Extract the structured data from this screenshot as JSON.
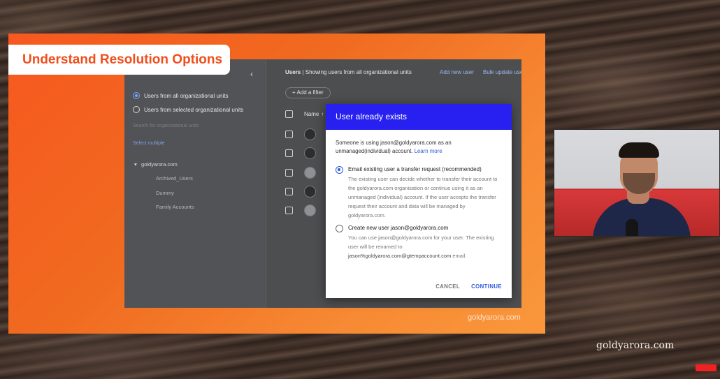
{
  "slide": {
    "title": "Understand Resolution Options",
    "footer": "goldyarora.com"
  },
  "console": {
    "left_panel": {
      "radio_all": "Users from all organizational units",
      "radio_selected": "Users from selected organizational units",
      "search_placeholder": "Search for organizational units",
      "select_multiple": "Select multiple",
      "tree_root": "goldyarora.com",
      "tree_children": [
        "Archived_Users",
        "Dummy",
        "Family Accounts"
      ]
    },
    "header": {
      "users": "Users",
      "showing": " | Showing users from all organizational units",
      "add_new_user": "Add new user",
      "bulk_update": "Bulk update users"
    },
    "filter": "+  Add a filter",
    "table": {
      "name_col": "Name"
    }
  },
  "modal": {
    "title": "User already exists",
    "intro": "Someone is using jason@goldyarora.com as an unmanaged(individual) account.",
    "learn_more": "Learn more",
    "option1": {
      "title": "Email existing user a transfer request (recommended)",
      "desc": "The existing user can decide whether to transfer their account to the goldyarora.com organisation or continue using it as an unmanaged (individual) account. If the user accepts the transfer request their account and data will be managed by goldyarora.com."
    },
    "option2": {
      "title": "Create new user jason@goldyarora.com",
      "desc": "You can use jason@goldyarora.com for your user. The existing user will be renamed to",
      "renamed_to": "jason%goldyarora.com@gtempaccount.com",
      "desc_end": " email."
    },
    "cancel": "CANCEL",
    "continue": "CONTINUE"
  },
  "brand": "goldyarora.com",
  "icons": {
    "collapse": "chevron-left-icon",
    "sort": "arrow-up-icon",
    "tree": "caret-down-icon"
  },
  "colors": {
    "slide_orange": "#f7581f",
    "modal_header": "#2720f0",
    "link_blue": "#2a5bd7"
  }
}
